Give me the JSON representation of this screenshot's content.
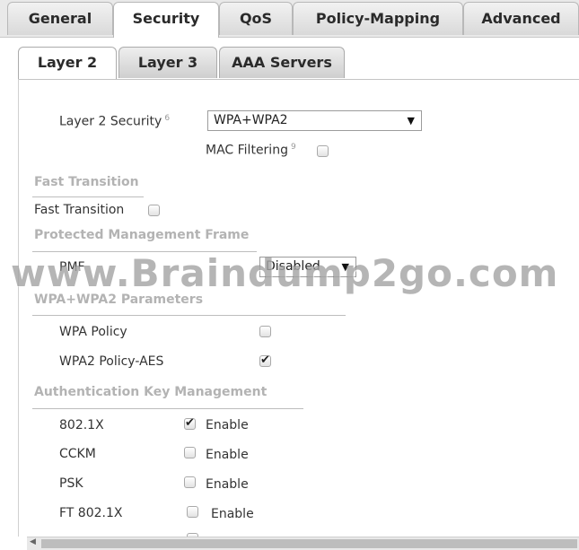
{
  "tabs": {
    "general": "General",
    "security": "Security",
    "qos": "QoS",
    "policy_mapping": "Policy-Mapping",
    "advanced": "Advanced"
  },
  "subtabs": {
    "layer2": "Layer 2",
    "layer3": "Layer 3",
    "aaa": "AAA Servers"
  },
  "layer2_security": {
    "label": "Layer 2 Security",
    "help": "6",
    "value": "WPA+WPA2",
    "mac_filtering_label": "MAC Filtering",
    "mac_filtering_help": "9",
    "mac_filtering_checked": false
  },
  "fast_transition": {
    "section": "Fast Transition",
    "label": "Fast Transition",
    "checked": false
  },
  "pmf": {
    "section": "Protected Management Frame",
    "label": "PMF",
    "value": "Disabled"
  },
  "wpa": {
    "section": "WPA+WPA2 Parameters",
    "policy_label": "WPA Policy",
    "policy_checked": false,
    "wpa2_label": "WPA2 Policy-AES",
    "wpa2_checked": true
  },
  "akm": {
    "section": "Authentication Key Management",
    "enable_label": "Enable",
    "items": [
      {
        "name": "802.1X",
        "checked": true
      },
      {
        "name": "CCKM",
        "checked": false
      },
      {
        "name": "PSK",
        "checked": false
      },
      {
        "name": "FT 802.1X",
        "checked": false
      }
    ]
  },
  "watermark": "www.Braindump2go.com"
}
